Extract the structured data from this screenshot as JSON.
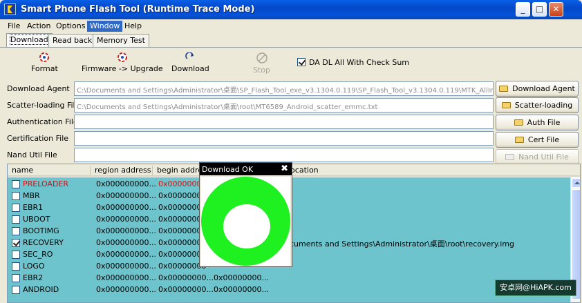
{
  "window": {
    "title": "Smart Phone Flash Tool (Runtime Trace Mode)",
    "minimize_glyph": "_",
    "maximize_glyph": "□",
    "close_glyph": "✕"
  },
  "menu": [
    "File",
    "Action",
    "Options",
    "Window",
    "Help"
  ],
  "tabs": [
    "Download",
    "Read back",
    "Memory Test"
  ],
  "toolbar": {
    "format": "Format",
    "firmware_upgrade": "Firmware -> Upgrade",
    "download": "Download",
    "stop": "Stop",
    "checksum": "DA DL All With Check Sum",
    "checksum_checked": true
  },
  "fields": {
    "download_agent": {
      "label": "Download Agent",
      "value": "C:\\Documents and Settings\\Administrator\\桌面\\SP_Flash_Tool_exe_v3.1304.0.119\\SP_Flash_Tool_v3.1304.0.119\\MTK_AllIn",
      "button": "Download Agent"
    },
    "scatter": {
      "label": "Scatter-loading File",
      "value": "C:\\Documents and Settings\\Administrator\\桌面\\root\\MT6589_Android_scatter_emmc.txt",
      "button": "Scatter-loading"
    },
    "auth": {
      "label": "Authentication File",
      "value": "",
      "button": "Auth File"
    },
    "cert": {
      "label": "Certification File",
      "value": "",
      "button": "Cert File"
    },
    "nand": {
      "label": "Nand Util File",
      "value": "",
      "button": "Nand Util File"
    }
  },
  "list": {
    "columns": [
      "name",
      "region address",
      "begin address",
      "location"
    ],
    "rows": [
      {
        "name": "PRELOADER",
        "checked": false,
        "region": "0x000000000...",
        "begin": "0x00000000",
        "end": "",
        "location": "",
        "red": true
      },
      {
        "name": "MBR",
        "checked": false,
        "region": "0x000000000...",
        "begin": "0x00000000",
        "end": "",
        "location": ""
      },
      {
        "name": "EBR1",
        "checked": false,
        "region": "0x000000000...",
        "begin": "0x00000000",
        "end": "",
        "location": ""
      },
      {
        "name": "UBOOT",
        "checked": false,
        "region": "0x000000000...",
        "begin": "0x00000000",
        "end": "",
        "location": ""
      },
      {
        "name": "BOOTIMG",
        "checked": false,
        "region": "0x000000000...",
        "begin": "0x00000000",
        "end": "",
        "location": ""
      },
      {
        "name": "RECOVERY",
        "checked": true,
        "region": "0x000000000...",
        "begin": "0x00000000",
        "end": "",
        "location": "cuments and Settings\\Administrator\\桌面\\root\\recovery.img"
      },
      {
        "name": "SEC_RO",
        "checked": false,
        "region": "0x000000000...",
        "begin": "0x00000000",
        "end": "",
        "location": ""
      },
      {
        "name": "LOGO",
        "checked": false,
        "region": "0x000000000...",
        "begin": "0x00000000",
        "end": "",
        "location": ""
      },
      {
        "name": "EBR2",
        "checked": false,
        "region": "0x000000000...",
        "begin": "0x00000000...",
        "end": "0x00000000...",
        "location": ""
      },
      {
        "name": "ANDROID",
        "checked": false,
        "region": "0x000000000...",
        "begin": "0x00000000...",
        "end": "0x00000000...",
        "location": ""
      }
    ]
  },
  "dialog": {
    "title": "Download OK",
    "close": "✖"
  },
  "watermark": "安卓网@HiAPK.com"
}
